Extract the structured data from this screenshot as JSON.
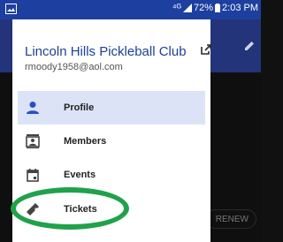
{
  "status_bar": {
    "signal": "⁴ᴳ",
    "battery_pct": "72%",
    "time": "2:03 PM"
  },
  "drawer": {
    "club_name": "Lincoln Hills Pickleball Club",
    "email": "rmoody1958@aol.com",
    "items": [
      {
        "label": "Profile",
        "icon": "person-icon",
        "active": true
      },
      {
        "label": "Members",
        "icon": "members-card-icon",
        "active": false
      },
      {
        "label": "Events",
        "icon": "calendar-icon",
        "active": false
      },
      {
        "label": "Tickets",
        "icon": "ticket-icon",
        "active": false
      }
    ]
  },
  "background": {
    "renew_label": "RENEW"
  },
  "colors": {
    "status_bar": "#1d3f9f",
    "app_bar": "#24347a",
    "accent": "#1f3f95",
    "active_bg": "#dde3f7",
    "annotation_green": "#1fa24a"
  }
}
